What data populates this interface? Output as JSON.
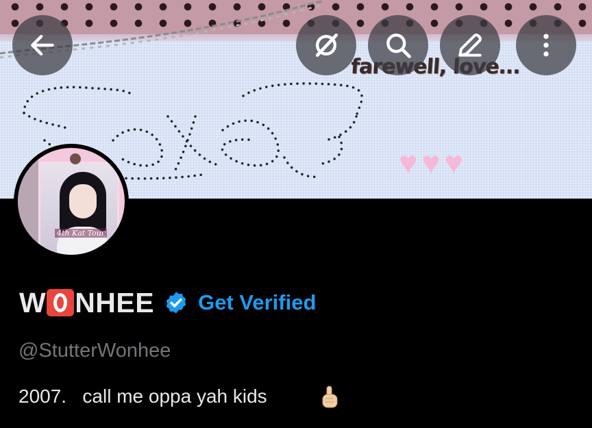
{
  "header": {
    "back_icon": "arrow-left-icon",
    "grok_icon": "grok-icon",
    "search_icon": "search-icon",
    "compose_icon": "pencil-icon",
    "more_icon": "more-vertical-icon"
  },
  "banner": {
    "text": "farewell, love...",
    "hearts": "♥♥♥",
    "colors": {
      "sky": "#cfdcf4",
      "pink_band": "#c49aa6",
      "hearts": "#f7b7d9"
    }
  },
  "avatar": {
    "label": "4th Kat Tour"
  },
  "profile": {
    "name_before": "W",
    "name_emoji": "O",
    "name_after": "NHEE",
    "verified_icon": "verified-badge-icon",
    "get_verified": "Get Verified",
    "handle": "@StutterWonhee",
    "bio": "2007.   call me oppa yah kids",
    "bio_emoji": "index-pointing-up-icon"
  },
  "colors": {
    "background": "#000000",
    "primary_text": "#e7e9ea",
    "secondary_text": "#71767b",
    "accent": "#1d9bf0"
  }
}
